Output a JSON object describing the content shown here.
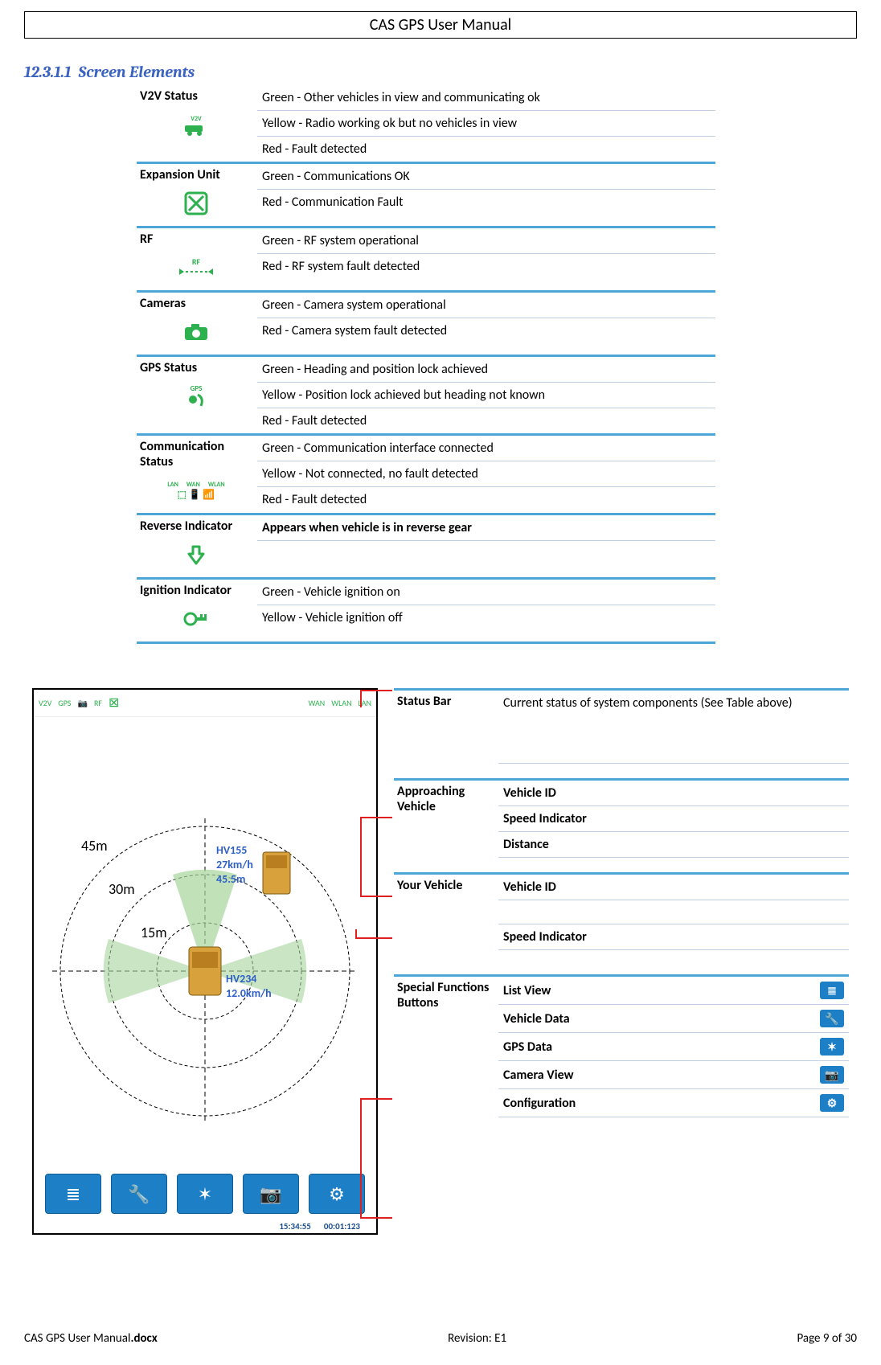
{
  "doc": {
    "header_title": "CAS GPS User Manual",
    "filename_prefix": "CAS GPS User Manual",
    "filename_ext": ".docx",
    "revision": "Revision: E1",
    "page_info": "Page 9 of 30"
  },
  "section": {
    "number": "12.3.1.1",
    "title": "Screen Elements"
  },
  "elements": [
    {
      "name": "V2V Status",
      "icon_text": "V2V",
      "lines": [
        "Green - Other vehicles in view and communicating ok",
        "Yellow - Radio working ok but no vehicles in view",
        "Red - Fault detected"
      ]
    },
    {
      "name": "Expansion Unit",
      "icon_text": "⊠",
      "lines": [
        "Green - Communications OK",
        "Red - Communication Fault"
      ]
    },
    {
      "name": "RF",
      "icon_text": "RF",
      "lines": [
        "Green - RF system operational",
        "Red - RF system fault detected"
      ]
    },
    {
      "name": "Cameras",
      "icon_text": "📷",
      "lines": [
        "Green - Camera system operational",
        "Red - Camera system fault detected"
      ]
    },
    {
      "name": "GPS Status",
      "icon_text": "GPS",
      "lines": [
        "Green - Heading and position lock achieved",
        "Yellow - Position lock achieved but heading not known",
        "Red - Fault detected"
      ]
    },
    {
      "name": "Communication Status",
      "icon_text": "LAN WAN WLAN",
      "lines": [
        "Green - Communication interface connected",
        "Yellow - Not connected, no fault detected",
        "Red - Fault detected"
      ]
    },
    {
      "name": "Reverse Indicator",
      "icon_text": "⬇",
      "lines": [
        "Appears when vehicle is in reverse gear"
      ]
    },
    {
      "name": "Ignition Indicator",
      "icon_text": "🔑",
      "lines": [
        "Green - Vehicle ignition on",
        "Yellow - Vehicle ignition off"
      ]
    }
  ],
  "radar": {
    "rings": [
      "15m",
      "30m",
      "45m"
    ],
    "approaching": {
      "id": "HV155",
      "speed": "27km/h",
      "distance": "45.5m"
    },
    "own": {
      "id": "HV234",
      "speed": "12.0km/h"
    }
  },
  "status_icons": [
    "V2V",
    "GPS",
    "📷",
    "RF",
    "⊠",
    "WAN",
    "WLAN",
    "LAN"
  ],
  "time": {
    "clock": "15:34:55",
    "elapsed": "00:01:123"
  },
  "callouts": {
    "status_bar": {
      "title": "Status Bar",
      "text": "Current status of system components (See Table above)"
    },
    "approaching": {
      "title": "Approaching Vehicle",
      "items": [
        "Vehicle ID",
        "Speed Indicator",
        "Distance"
      ]
    },
    "your": {
      "title": "Your Vehicle",
      "items": [
        "Vehicle ID",
        "Speed Indicator"
      ]
    },
    "special": {
      "title": "Special Functions Buttons",
      "items": [
        {
          "label": "List View",
          "glyph": "≣"
        },
        {
          "label": "Vehicle Data",
          "glyph": "🔧"
        },
        {
          "label": "GPS Data",
          "glyph": "✶"
        },
        {
          "label": "Camera View",
          "glyph": "📷"
        },
        {
          "label": "Configuration",
          "glyph": "⚙"
        }
      ]
    }
  }
}
